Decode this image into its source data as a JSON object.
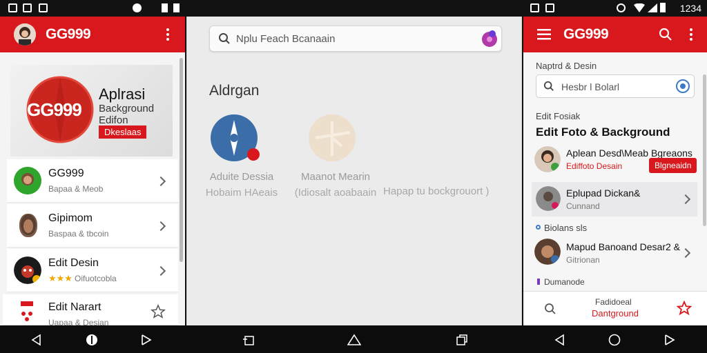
{
  "status_bar": {
    "time": "1234"
  },
  "left": {
    "app_title": "GG999",
    "banner": {
      "logo_text": "GG999",
      "title": "Aplrasi",
      "line2": "Background",
      "line3": "Edifon",
      "tag": "Dkeslaas"
    },
    "items": [
      {
        "title": "GG999",
        "subtitle": "Bapaa & Meob"
      },
      {
        "title": "Gipimom",
        "subtitle": "Baspaa & tbcoin"
      },
      {
        "title": "Edit Desin",
        "subtitle": "Oifuotcobla",
        "stars": "★★★"
      },
      {
        "title": "Edit Narart",
        "subtitle": "Uapaa & Desian"
      }
    ]
  },
  "middle": {
    "search_placeholder": "Nplu Feach Bcanaain",
    "heading": "Aldrgan",
    "apps": [
      {
        "name": "Aduite Dessia",
        "sub": "Hobaim HAeais"
      },
      {
        "name": "Maanot Mearin",
        "sub": "(Idiosalt aoabaain"
      }
    ],
    "extra_caption": "Hapap tu bockgrouort )"
  },
  "right": {
    "app_title": "GG999",
    "search_label": "Naptrd & Desin",
    "search_placeholder": "Hesbr l Bolarl",
    "section_small": "Edit Fosiak",
    "section_title": "Edit Foto & Background",
    "featured": {
      "line1": "Aplean Desd\\Meab Bgreaons",
      "line2": "Ediffoto Desain",
      "button": "Blgneaidn"
    },
    "item2": {
      "line1": "Eplupad Dickan&",
      "line2": "Cunnand"
    },
    "label2": "Biolans sls",
    "item3": {
      "line1": "Mapud Banoand Desar2 &",
      "line2": "Gitrionan"
    },
    "label3": "Dumanode",
    "bottom": {
      "line1": "Fadidoeal",
      "line2": "Dantground"
    }
  },
  "colors": {
    "brand_red": "#d8181c",
    "blue_accent": "#3b6ea8"
  }
}
